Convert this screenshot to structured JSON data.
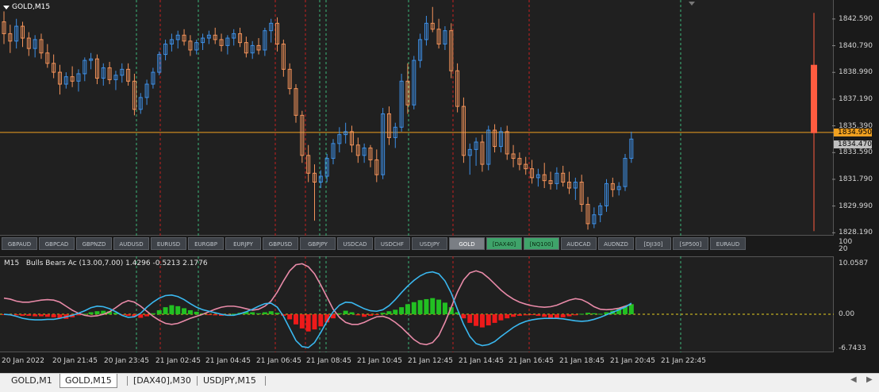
{
  "chart": {
    "symbol": "GOLD,M15"
  },
  "price_axis": {
    "labels": [
      "1842.590",
      "1840.790",
      "1838.990",
      "1837.190",
      "1835.390",
      "1833.590",
      "1831.790",
      "1829.990",
      "1828.190"
    ],
    "ask_tag": "1834.950",
    "bid_tag": "1834.470",
    "ask_color": "#f0a020",
    "bid_color": "#c0c0c0"
  },
  "oscillator": {
    "timeframe": "M15",
    "name": "Bulls Bears Ac",
    "params": "(13.00,7.00)",
    "val1": "1.4296",
    "val2": "-0.5213",
    "val3": "2.1776",
    "axis_labels": [
      "10.0587",
      "0.00",
      "-6.7433"
    ],
    "scale_labels": [
      "100",
      "20"
    ]
  },
  "symbol_buttons": [
    {
      "label": "GBPAUD",
      "state": "normal"
    },
    {
      "label": "GBPCAD",
      "state": "normal"
    },
    {
      "label": "GBPNZD",
      "state": "normal"
    },
    {
      "label": "AUDUSD",
      "state": "normal"
    },
    {
      "label": "EURUSD",
      "state": "normal"
    },
    {
      "label": "EURGBP",
      "state": "normal"
    },
    {
      "label": "EURJPY",
      "state": "normal"
    },
    {
      "label": "GBPUSD",
      "state": "normal"
    },
    {
      "label": "GBPJPY",
      "state": "normal"
    },
    {
      "label": "USDCAD",
      "state": "normal"
    },
    {
      "label": "USDCHF",
      "state": "normal"
    },
    {
      "label": "USDJPY",
      "state": "normal"
    },
    {
      "label": "GOLD",
      "state": "active"
    },
    {
      "label": "[DAX40]",
      "state": "green"
    },
    {
      "label": "[NQ100]",
      "state": "green"
    },
    {
      "label": "AUDCAD",
      "state": "normal"
    },
    {
      "label": "AUDNZD",
      "state": "normal"
    },
    {
      "label": "[DJI30]",
      "state": "normal"
    },
    {
      "label": "[SP500]",
      "state": "normal"
    },
    {
      "label": "EURAUD",
      "state": "normal"
    }
  ],
  "time_axis": [
    "20 Jan 2022",
    "20 Jan 21:45",
    "20 Jan 23:45",
    "21 Jan 02:45",
    "21 Jan 04:45",
    "21 Jan 06:45",
    "21 Jan 08:45",
    "21 Jan 10:45",
    "21 Jan 12:45",
    "21 Jan 14:45",
    "21 Jan 16:45",
    "21 Jan 18:45",
    "21 Jan 20:45",
    "21 Jan 22:45"
  ],
  "tabs": [
    "GOLD,M1",
    "GOLD,M15",
    "[DAX40],M30",
    "USDJPY,M15"
  ],
  "active_tab": "GOLD,M15",
  "colors": {
    "bull": "#3d8fe6",
    "bear": "#f4935a",
    "pink_line": "#e88aa8",
    "blue_line": "#3ab8f0",
    "hist_up": "#22c022",
    "hist_down": "#ee1a1a",
    "zero_line": "#e6d020",
    "green_vline": "#3db87a",
    "red_vline": "#c62020"
  },
  "chart_data": {
    "type": "candlestick",
    "timeframe": "M15",
    "ylim": [
      1828.1,
      1843.6
    ],
    "candles": [
      [
        1842.4,
        1843.1,
        1840.9,
        1841.6
      ],
      [
        1841.6,
        1842.2,
        1840.3,
        1841.1
      ],
      [
        1841.1,
        1842.6,
        1840.6,
        1842.1
      ],
      [
        1842.1,
        1842.4,
        1840.7,
        1841.3
      ],
      [
        1841.3,
        1841.7,
        1840.1,
        1840.6
      ],
      [
        1840.6,
        1841.5,
        1840.0,
        1841.2
      ],
      [
        1841.2,
        1841.6,
        1839.9,
        1840.3
      ],
      [
        1840.3,
        1840.9,
        1839.3,
        1839.6
      ],
      [
        1839.6,
        1840.2,
        1838.6,
        1839.0
      ],
      [
        1839.0,
        1839.5,
        1837.5,
        1838.2
      ],
      [
        1838.2,
        1839.0,
        1837.9,
        1838.7
      ],
      [
        1838.7,
        1839.4,
        1838.0,
        1838.4
      ],
      [
        1838.4,
        1839.2,
        1837.7,
        1838.9
      ],
      [
        1838.9,
        1840.0,
        1838.4,
        1839.8
      ],
      [
        1839.8,
        1840.3,
        1839.2,
        1839.9
      ],
      [
        1839.9,
        1840.2,
        1838.2,
        1838.6
      ],
      [
        1838.6,
        1839.6,
        1838.1,
        1839.3
      ],
      [
        1839.3,
        1839.7,
        1838.2,
        1838.5
      ],
      [
        1838.5,
        1839.1,
        1837.8,
        1838.8
      ],
      [
        1838.8,
        1839.6,
        1838.3,
        1839.2
      ],
      [
        1839.2,
        1839.6,
        1838.1,
        1838.4
      ],
      [
        1838.4,
        1838.9,
        1836.1,
        1836.5
      ],
      [
        1836.5,
        1837.6,
        1836.2,
        1837.3
      ],
      [
        1837.3,
        1838.5,
        1836.8,
        1838.2
      ],
      [
        1838.2,
        1839.3,
        1837.9,
        1839.0
      ],
      [
        1839.0,
        1840.4,
        1838.8,
        1840.2
      ],
      [
        1840.2,
        1841.2,
        1839.8,
        1840.9
      ],
      [
        1840.9,
        1841.6,
        1840.4,
        1841.2
      ],
      [
        1841.2,
        1841.8,
        1840.6,
        1841.5
      ],
      [
        1841.5,
        1841.9,
        1840.8,
        1841.1
      ],
      [
        1841.1,
        1841.5,
        1840.1,
        1840.5
      ],
      [
        1840.5,
        1841.2,
        1840.2,
        1841.0
      ],
      [
        1841.0,
        1841.6,
        1840.5,
        1841.3
      ],
      [
        1841.3,
        1841.8,
        1840.9,
        1841.5
      ],
      [
        1841.5,
        1842.0,
        1840.9,
        1841.2
      ],
      [
        1841.2,
        1841.6,
        1840.4,
        1840.8
      ],
      [
        1840.8,
        1841.5,
        1840.2,
        1841.3
      ],
      [
        1841.3,
        1841.9,
        1840.8,
        1841.6
      ],
      [
        1841.6,
        1842.0,
        1840.7,
        1841.0
      ],
      [
        1841.0,
        1841.4,
        1840.0,
        1840.3
      ],
      [
        1840.3,
        1841.1,
        1839.9,
        1840.8
      ],
      [
        1840.8,
        1841.3,
        1840.2,
        1840.5
      ],
      [
        1840.5,
        1842.0,
        1840.1,
        1841.8
      ],
      [
        1841.8,
        1842.6,
        1841.0,
        1842.3
      ],
      [
        1842.3,
        1842.7,
        1840.4,
        1840.9
      ],
      [
        1840.9,
        1841.2,
        1838.7,
        1839.2
      ],
      [
        1839.2,
        1839.6,
        1837.5,
        1837.9
      ],
      [
        1837.9,
        1838.2,
        1835.6,
        1836.1
      ],
      [
        1836.1,
        1836.4,
        1832.9,
        1833.4
      ],
      [
        1833.4,
        1834.1,
        1831.6,
        1832.2
      ],
      [
        1832.2,
        1832.8,
        1829.0,
        1831.6
      ],
      [
        1831.6,
        1832.4,
        1831.2,
        1832.0
      ],
      [
        1832.0,
        1833.5,
        1831.6,
        1833.2
      ],
      [
        1833.2,
        1834.5,
        1832.8,
        1834.2
      ],
      [
        1834.2,
        1835.3,
        1833.6,
        1834.8
      ],
      [
        1834.8,
        1835.6,
        1834.2,
        1835.0
      ],
      [
        1835.0,
        1835.4,
        1833.6,
        1834.1
      ],
      [
        1834.1,
        1834.6,
        1832.9,
        1833.4
      ],
      [
        1833.4,
        1834.2,
        1832.9,
        1833.9
      ],
      [
        1833.9,
        1834.1,
        1832.6,
        1833.1
      ],
      [
        1833.1,
        1833.8,
        1831.6,
        1832.1
      ],
      [
        1832.1,
        1836.6,
        1831.8,
        1836.2
      ],
      [
        1836.2,
        1836.7,
        1834.1,
        1834.6
      ],
      [
        1834.6,
        1835.6,
        1833.9,
        1835.3
      ],
      [
        1835.3,
        1838.9,
        1835.0,
        1838.4
      ],
      [
        1838.4,
        1839.6,
        1836.2,
        1836.8
      ],
      [
        1836.8,
        1840.1,
        1836.5,
        1839.8
      ],
      [
        1839.8,
        1841.6,
        1839.3,
        1841.2
      ],
      [
        1841.2,
        1842.8,
        1840.8,
        1842.3
      ],
      [
        1842.3,
        1843.4,
        1841.7,
        1841.9
      ],
      [
        1841.9,
        1842.6,
        1840.6,
        1840.9
      ],
      [
        1840.9,
        1842.1,
        1840.5,
        1841.8
      ],
      [
        1841.8,
        1842.3,
        1838.6,
        1839.1
      ],
      [
        1839.1,
        1839.6,
        1836.3,
        1836.7
      ],
      [
        1836.7,
        1837.3,
        1832.9,
        1833.4
      ],
      [
        1833.4,
        1834.2,
        1832.1,
        1833.8
      ],
      [
        1833.8,
        1834.6,
        1832.7,
        1834.3
      ],
      [
        1834.3,
        1834.8,
        1832.3,
        1832.8
      ],
      [
        1832.8,
        1835.4,
        1832.4,
        1835.1
      ],
      [
        1835.1,
        1835.5,
        1833.6,
        1834.0
      ],
      [
        1834.0,
        1835.3,
        1833.6,
        1835.0
      ],
      [
        1835.0,
        1835.4,
        1833.1,
        1833.5
      ],
      [
        1833.5,
        1834.1,
        1832.6,
        1833.2
      ],
      [
        1833.2,
        1833.6,
        1832.4,
        1832.8
      ],
      [
        1832.8,
        1833.3,
        1832.1,
        1832.5
      ],
      [
        1832.5,
        1833.1,
        1831.5,
        1831.9
      ],
      [
        1831.9,
        1832.5,
        1831.3,
        1832.1
      ],
      [
        1832.1,
        1832.9,
        1831.2,
        1831.7
      ],
      [
        1831.7,
        1832.3,
        1831.1,
        1831.5
      ],
      [
        1831.5,
        1832.6,
        1831.1,
        1832.2
      ],
      [
        1832.2,
        1832.7,
        1831.3,
        1831.6
      ],
      [
        1831.6,
        1832.3,
        1830.8,
        1831.2
      ],
      [
        1831.2,
        1831.9,
        1830.4,
        1831.6
      ],
      [
        1831.6,
        1832.1,
        1829.6,
        1830.1
      ],
      [
        1830.1,
        1830.6,
        1828.4,
        1828.8
      ],
      [
        1828.8,
        1829.9,
        1828.5,
        1829.4
      ],
      [
        1829.4,
        1830.2,
        1828.9,
        1830.0
      ],
      [
        1830.0,
        1831.8,
        1829.6,
        1831.5
      ],
      [
        1831.5,
        1831.9,
        1830.6,
        1831.1
      ],
      [
        1831.1,
        1831.6,
        1830.7,
        1831.3
      ],
      [
        1831.3,
        1833.5,
        1831.0,
        1833.2
      ],
      [
        1833.2,
        1835.0,
        1832.9,
        1834.5
      ]
    ],
    "oscillator": {
      "name": "Bulls Bears Ac",
      "ylim": [
        -6.7433,
        10.0587
      ],
      "levels": [
        0
      ],
      "histogram": [
        -0.1,
        -0.2,
        -0.2,
        -0.3,
        -0.3,
        -0.4,
        -0.4,
        -0.5,
        -0.6,
        -0.8,
        -0.9,
        -0.6,
        -0.2,
        0.1,
        0.4,
        0.6,
        0.7,
        0.6,
        0.3,
        -0.1,
        -0.3,
        -0.5,
        -0.7,
        -0.4,
        0.2,
        0.8,
        1.4,
        1.8,
        1.6,
        1.2,
        0.8,
        0.5,
        0.2,
        -0.1,
        -0.2,
        -0.3,
        -0.1,
        0.1,
        0.3,
        0.5,
        0.4,
        0.2,
        0.4,
        0.6,
        0.3,
        -0.3,
        -1.0,
        -2.0,
        -2.8,
        -3.4,
        -3.0,
        -2.4,
        -1.6,
        -0.8,
        0.2,
        0.7,
        0.4,
        -0.2,
        -0.5,
        -0.3,
        -0.1,
        0.3,
        0.6,
        0.9,
        1.4,
        2.0,
        2.4,
        2.8,
        3.0,
        3.2,
        2.9,
        2.3,
        1.4,
        0.4,
        -0.8,
        -1.7,
        -2.3,
        -2.6,
        -2.2,
        -1.7,
        -1.2,
        -0.8,
        -0.5,
        -0.3,
        -0.2,
        -0.1,
        -0.3,
        -0.5,
        -0.7,
        -0.8,
        -0.6,
        -0.4,
        -0.2,
        0.1,
        0.3,
        0.2,
        0.1,
        0.4,
        0.7,
        1.2,
        1.6,
        2.0
      ],
      "pink_line": [
        3.2,
        3.0,
        2.6,
        2.4,
        2.4,
        2.6,
        2.8,
        2.9,
        2.8,
        2.4,
        1.6,
        0.8,
        0.2,
        -0.2,
        -0.4,
        -0.3,
        0.0,
        0.5,
        1.3,
        2.2,
        2.7,
        2.4,
        1.6,
        0.6,
        -0.4,
        -1.2,
        -1.8,
        -2.0,
        -1.8,
        -1.3,
        -0.8,
        -0.4,
        0.0,
        0.5,
        1.0,
        1.4,
        1.6,
        1.6,
        1.4,
        1.1,
        0.8,
        1.0,
        1.6,
        2.6,
        4.4,
        6.6,
        8.6,
        9.8,
        10.0,
        9.4,
        8.0,
        5.8,
        3.4,
        1.0,
        -0.6,
        -1.6,
        -2.0,
        -2.0,
        -1.6,
        -1.0,
        -0.5,
        -0.4,
        -0.8,
        -1.6,
        -2.6,
        -3.8,
        -5.0,
        -5.8,
        -6.0,
        -5.6,
        -4.2,
        -1.6,
        1.4,
        4.4,
        6.8,
        8.2,
        8.6,
        8.2,
        7.2,
        6.0,
        4.8,
        3.8,
        3.0,
        2.4,
        2.0,
        1.7,
        1.5,
        1.4,
        1.5,
        1.8,
        2.3,
        2.8,
        3.1,
        2.9,
        2.3,
        1.5,
        1.0,
        0.9,
        1.0,
        1.2,
        1.6,
        2.0
      ],
      "blue_line": [
        0.0,
        -0.1,
        -0.4,
        -0.8,
        -1.0,
        -1.1,
        -1.1,
        -1.0,
        -1.0,
        -0.8,
        -0.5,
        -0.2,
        0.2,
        0.7,
        1.3,
        1.6,
        1.5,
        1.1,
        0.5,
        -0.2,
        -0.6,
        -0.5,
        0.2,
        1.4,
        2.4,
        3.2,
        3.7,
        3.8,
        3.5,
        2.9,
        2.1,
        1.4,
        0.9,
        0.6,
        0.3,
        0.0,
        -0.2,
        -0.2,
        0.1,
        0.5,
        1.0,
        1.6,
        2.1,
        2.2,
        1.4,
        -0.4,
        -2.8,
        -5.2,
        -6.4,
        -6.6,
        -5.6,
        -3.6,
        -1.4,
        0.5,
        1.8,
        2.4,
        2.3,
        1.7,
        1.1,
        0.7,
        0.6,
        0.9,
        1.7,
        2.9,
        4.3,
        5.6,
        6.7,
        7.6,
        8.2,
        8.4,
        8.0,
        6.6,
        4.2,
        1.0,
        -2.0,
        -4.4,
        -5.8,
        -6.2,
        -6.0,
        -5.4,
        -4.4,
        -3.5,
        -2.6,
        -1.9,
        -1.4,
        -1.1,
        -0.9,
        -0.8,
        -0.8,
        -0.8,
        -0.9,
        -1.1,
        -1.3,
        -1.4,
        -1.3,
        -1.0,
        -0.6,
        -0.1,
        0.4,
        0.9,
        1.4,
        2.2
      ]
    },
    "current_price_line": 1834.95
  }
}
